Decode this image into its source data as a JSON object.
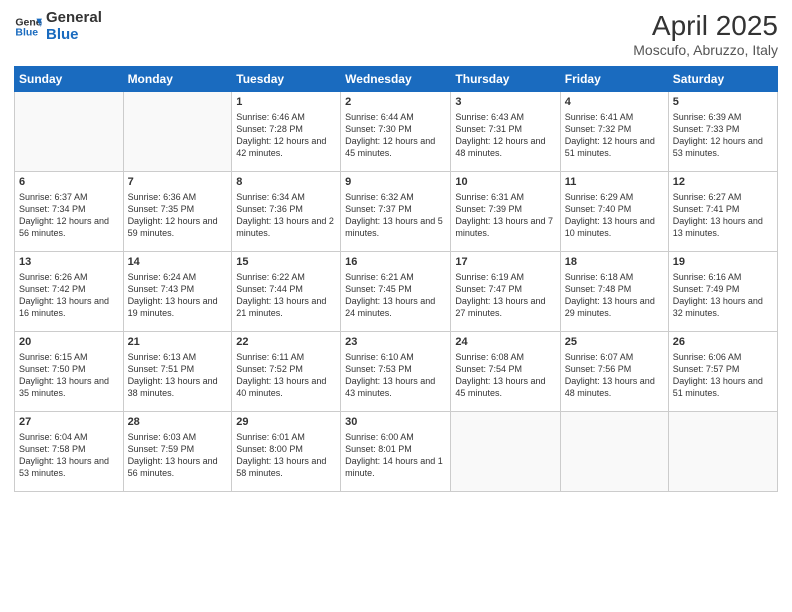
{
  "header": {
    "logo_line1": "General",
    "logo_line2": "Blue",
    "month_title": "April 2025",
    "location": "Moscufo, Abruzzo, Italy"
  },
  "days_of_week": [
    "Sunday",
    "Monday",
    "Tuesday",
    "Wednesday",
    "Thursday",
    "Friday",
    "Saturday"
  ],
  "weeks": [
    [
      {
        "day": "",
        "info": ""
      },
      {
        "day": "",
        "info": ""
      },
      {
        "day": "1",
        "info": "Sunrise: 6:46 AM\nSunset: 7:28 PM\nDaylight: 12 hours and 42 minutes."
      },
      {
        "day": "2",
        "info": "Sunrise: 6:44 AM\nSunset: 7:30 PM\nDaylight: 12 hours and 45 minutes."
      },
      {
        "day": "3",
        "info": "Sunrise: 6:43 AM\nSunset: 7:31 PM\nDaylight: 12 hours and 48 minutes."
      },
      {
        "day": "4",
        "info": "Sunrise: 6:41 AM\nSunset: 7:32 PM\nDaylight: 12 hours and 51 minutes."
      },
      {
        "day": "5",
        "info": "Sunrise: 6:39 AM\nSunset: 7:33 PM\nDaylight: 12 hours and 53 minutes."
      }
    ],
    [
      {
        "day": "6",
        "info": "Sunrise: 6:37 AM\nSunset: 7:34 PM\nDaylight: 12 hours and 56 minutes."
      },
      {
        "day": "7",
        "info": "Sunrise: 6:36 AM\nSunset: 7:35 PM\nDaylight: 12 hours and 59 minutes."
      },
      {
        "day": "8",
        "info": "Sunrise: 6:34 AM\nSunset: 7:36 PM\nDaylight: 13 hours and 2 minutes."
      },
      {
        "day": "9",
        "info": "Sunrise: 6:32 AM\nSunset: 7:37 PM\nDaylight: 13 hours and 5 minutes."
      },
      {
        "day": "10",
        "info": "Sunrise: 6:31 AM\nSunset: 7:39 PM\nDaylight: 13 hours and 7 minutes."
      },
      {
        "day": "11",
        "info": "Sunrise: 6:29 AM\nSunset: 7:40 PM\nDaylight: 13 hours and 10 minutes."
      },
      {
        "day": "12",
        "info": "Sunrise: 6:27 AM\nSunset: 7:41 PM\nDaylight: 13 hours and 13 minutes."
      }
    ],
    [
      {
        "day": "13",
        "info": "Sunrise: 6:26 AM\nSunset: 7:42 PM\nDaylight: 13 hours and 16 minutes."
      },
      {
        "day": "14",
        "info": "Sunrise: 6:24 AM\nSunset: 7:43 PM\nDaylight: 13 hours and 19 minutes."
      },
      {
        "day": "15",
        "info": "Sunrise: 6:22 AM\nSunset: 7:44 PM\nDaylight: 13 hours and 21 minutes."
      },
      {
        "day": "16",
        "info": "Sunrise: 6:21 AM\nSunset: 7:45 PM\nDaylight: 13 hours and 24 minutes."
      },
      {
        "day": "17",
        "info": "Sunrise: 6:19 AM\nSunset: 7:47 PM\nDaylight: 13 hours and 27 minutes."
      },
      {
        "day": "18",
        "info": "Sunrise: 6:18 AM\nSunset: 7:48 PM\nDaylight: 13 hours and 29 minutes."
      },
      {
        "day": "19",
        "info": "Sunrise: 6:16 AM\nSunset: 7:49 PM\nDaylight: 13 hours and 32 minutes."
      }
    ],
    [
      {
        "day": "20",
        "info": "Sunrise: 6:15 AM\nSunset: 7:50 PM\nDaylight: 13 hours and 35 minutes."
      },
      {
        "day": "21",
        "info": "Sunrise: 6:13 AM\nSunset: 7:51 PM\nDaylight: 13 hours and 38 minutes."
      },
      {
        "day": "22",
        "info": "Sunrise: 6:11 AM\nSunset: 7:52 PM\nDaylight: 13 hours and 40 minutes."
      },
      {
        "day": "23",
        "info": "Sunrise: 6:10 AM\nSunset: 7:53 PM\nDaylight: 13 hours and 43 minutes."
      },
      {
        "day": "24",
        "info": "Sunrise: 6:08 AM\nSunset: 7:54 PM\nDaylight: 13 hours and 45 minutes."
      },
      {
        "day": "25",
        "info": "Sunrise: 6:07 AM\nSunset: 7:56 PM\nDaylight: 13 hours and 48 minutes."
      },
      {
        "day": "26",
        "info": "Sunrise: 6:06 AM\nSunset: 7:57 PM\nDaylight: 13 hours and 51 minutes."
      }
    ],
    [
      {
        "day": "27",
        "info": "Sunrise: 6:04 AM\nSunset: 7:58 PM\nDaylight: 13 hours and 53 minutes."
      },
      {
        "day": "28",
        "info": "Sunrise: 6:03 AM\nSunset: 7:59 PM\nDaylight: 13 hours and 56 minutes."
      },
      {
        "day": "29",
        "info": "Sunrise: 6:01 AM\nSunset: 8:00 PM\nDaylight: 13 hours and 58 minutes."
      },
      {
        "day": "30",
        "info": "Sunrise: 6:00 AM\nSunset: 8:01 PM\nDaylight: 14 hours and 1 minute."
      },
      {
        "day": "",
        "info": ""
      },
      {
        "day": "",
        "info": ""
      },
      {
        "day": "",
        "info": ""
      }
    ]
  ]
}
